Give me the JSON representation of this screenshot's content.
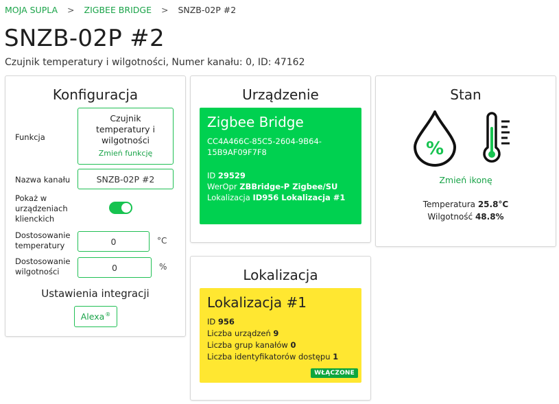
{
  "breadcrumb": {
    "home": "MOJA SUPLA",
    "parent": "ZIGBEE BRIDGE",
    "separator": ">",
    "current": "SNZB-02P #2"
  },
  "page": {
    "title": "SNZB-02P #2",
    "subtitle": "Czujnik temperatury i wilgotności, Numer kanału: 0, ID: 47162"
  },
  "config": {
    "title": "Konfiguracja",
    "function_label": "Funkcja",
    "function_value_line1": "Czujnik",
    "function_value_line2": "temperatury i",
    "function_value_line3": "wilgotności",
    "function_change": "Zmień funkcję",
    "channel_name_label": "Nazwa kanału",
    "channel_name_value": "SNZB-02P #2",
    "show_in_clients_line1": "Pokaż w",
    "show_in_clients_line2": "urządzeniach",
    "show_in_clients_line3": "klienckich",
    "show_in_clients_enabled": true,
    "temp_adjust_line1": "Dostosowanie",
    "temp_adjust_line2": "temperatury",
    "temp_adjust_value": "0",
    "temp_unit": "°C",
    "hum_adjust_line1": "Dostosowanie",
    "hum_adjust_line2": "wilgotności",
    "hum_adjust_value": "0",
    "hum_unit": "%",
    "integrations_title": "Ustawienia integracji",
    "alexa_label": "Alexa",
    "alexa_mark": "®"
  },
  "device": {
    "title": "Urządzenie",
    "name": "Zigbee Bridge",
    "guid_line1": "CC4A466C-85C5-2604-9B64-",
    "guid_line2": "15B9AF09F7F8",
    "id_label": "ID",
    "id_value": "29529",
    "weropr_label": "WerOpr",
    "weropr_value": "ZBBridge-P Zigbee/SU",
    "location_label": "Lokalizacja",
    "location_value": "ID956 Lokalizacja #1",
    "panel_color": "#00d150"
  },
  "state": {
    "title": "Stan",
    "humidity_icon": "humidity-drop-icon",
    "thermometer_icon": "thermometer-icon",
    "change_icon": "Zmień ikonę",
    "temperature_label": "Temperatura",
    "temperature_value": "25.8°C",
    "humidity_label": "Wilgotność",
    "humidity_value": "48.8%"
  },
  "location": {
    "title": "Lokalizacja",
    "name": "Lokalizacja #1",
    "id_label": "ID",
    "id_value": "956",
    "devices_label": "Liczba urządzeń",
    "devices_value": "9",
    "groups_label": "Liczba grup kanałów",
    "groups_value": "0",
    "access_ids_label": "Liczba identyfikatorów dostępu",
    "access_ids_value": "1",
    "status_badge": "WŁĄCZONE",
    "panel_color": "#ffe731"
  },
  "colors": {
    "accent": "#19a348",
    "switch_on": "#17c350"
  }
}
